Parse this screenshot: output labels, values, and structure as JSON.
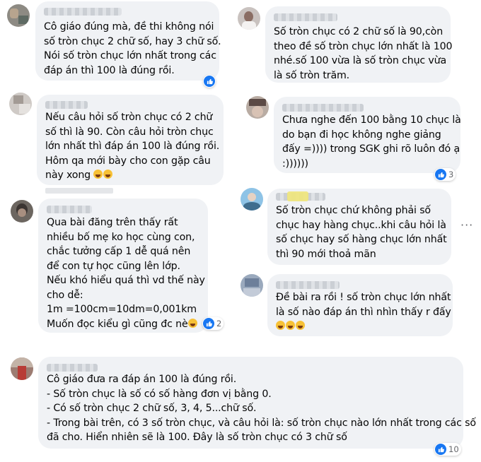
{
  "comments": [
    {
      "id": "c1",
      "lines": [
        "Cô giáo đúng mà, đề thi không nói",
        "số tròn chục 2 chữ số, hay 3 chữ số.",
        "Nói số tròn chục lớn nhất trong các",
        "đáp án thì 100 là đúng rồi."
      ],
      "reaction": {
        "type": "like",
        "count": ""
      }
    },
    {
      "id": "c2",
      "lines": [
        "Số tròn chục có 2 chữ số là 90,còn",
        "theo đề số tròn chục lớn nhất là 100",
        "nhé.số 100 vừa là số tròn chục vừa",
        "là số tròn trăm."
      ],
      "reaction": null
    },
    {
      "id": "c3",
      "lines": [
        "Nếu câu hỏi số tròn chục có 2 chữ",
        "số thì là 90. Còn câu hỏi tròn chục",
        "lớn nhất thì đáp án 100 là đúng rồi.",
        "Hôm qa mới bày cho con gặp câu",
        "này xong"
      ],
      "reaction": null
    },
    {
      "id": "c4",
      "lines": [
        "Chưa nghe đến 100 bằng 10 chục là",
        "do bạn đi học không nghe giảng",
        "đấy =)))) trong SGK ghi rõ luôn đó ạ",
        ":))))))"
      ],
      "reaction": {
        "type": "like",
        "count": "3"
      }
    },
    {
      "id": "c5",
      "lines": [
        "Qua bài đăng trên thấy rất",
        "nhiều bố mẹ ko học cùng con,",
        "chắc tưởng cấp 1 dễ quá nên",
        "để con tự học cũng lên lớp.",
        "Nếu khó hiểu quá thì vd thế này",
        "cho dễ:",
        "1m =100cm=10dm=0,001km",
        "Muốn đọc kiểu gì cũng đc nè"
      ],
      "reaction": {
        "type": "like",
        "count": "2"
      }
    },
    {
      "id": "c6",
      "lines": [
        "Số tròn chục chứ không phải số",
        "chục hay hàng chục..khi câu hỏi là",
        "số chục hay số hàng chục lớn nhất",
        "thì 90 mới thoả mãn"
      ],
      "reaction": null
    },
    {
      "id": "c7",
      "lines": [
        "Đề bài ra rồi ! số tròn chục lớn nhất",
        "là số nào đáp án thì nhìn thấy r đấy"
      ],
      "reaction": null
    },
    {
      "id": "c8",
      "lines": [
        "Cô giáo đưa ra đáp án 100 là đúng rồi.",
        "- Số tròn chục là số có số hàng đơn vị bằng 0.",
        "- Có số tròn chục 2 chữ số, 3, 4, 5...chữ số.",
        "- Trong bài trên, có 3 số tròn chục, và câu hỏi là: số tròn chục nào lớn nhất trong các số",
        "đã cho. Hiển nhiên sẽ là 100. Đây là số tròn chục có 3 chữ số"
      ],
      "reaction": {
        "type": "like",
        "count": "10"
      }
    }
  ],
  "more_menu": "···"
}
